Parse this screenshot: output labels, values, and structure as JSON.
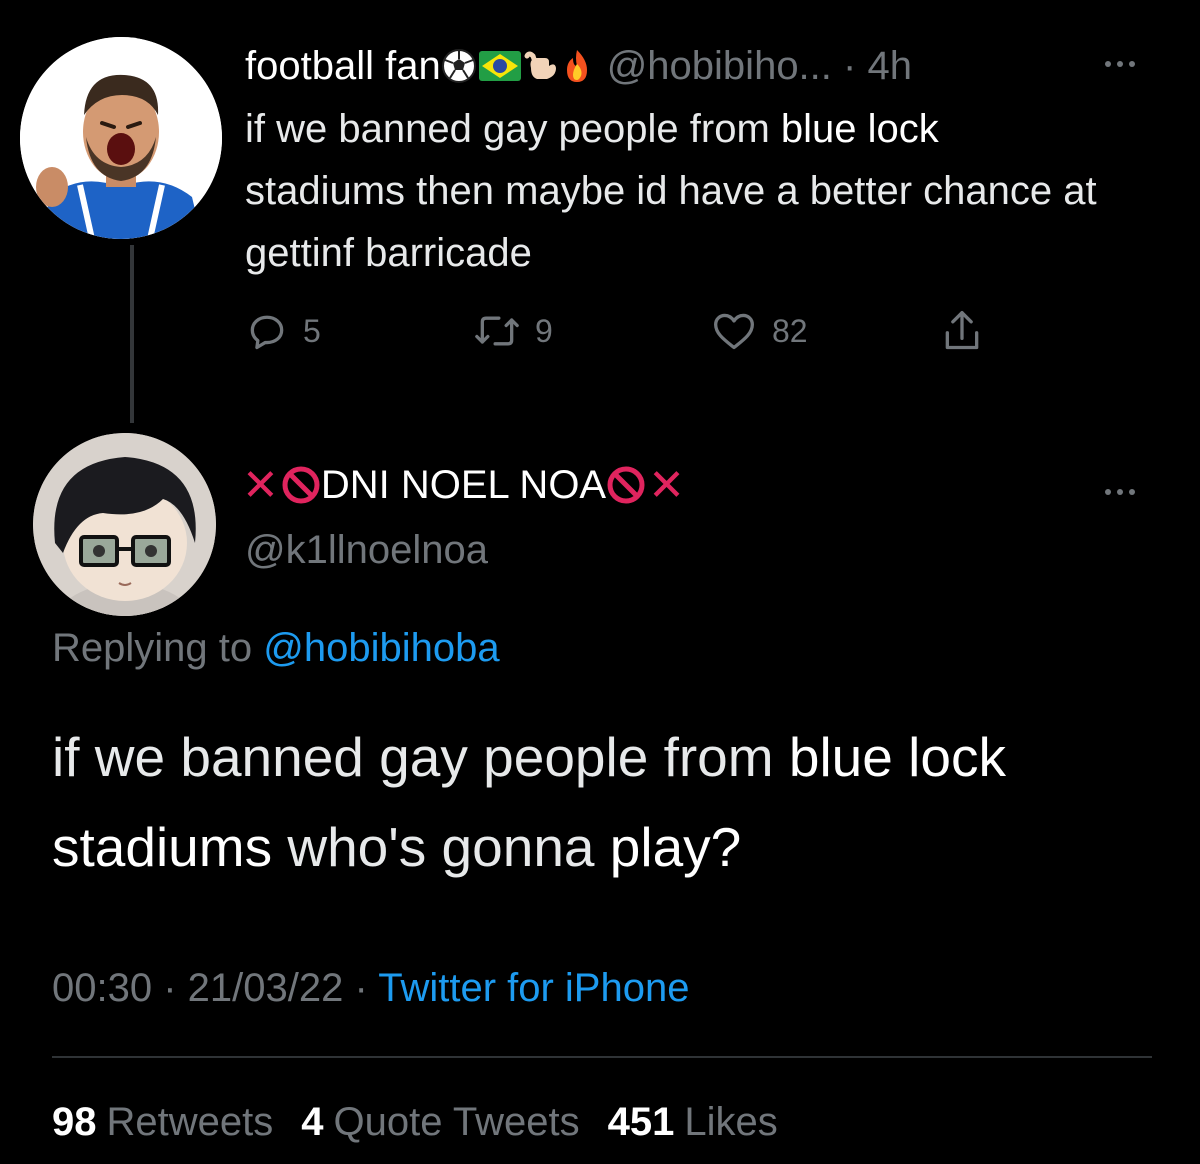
{
  "tweet": {
    "display_name": "football fan",
    "name_emojis": [
      "soccer-ball-icon",
      "brazil-flag-icon",
      "call-me-hand-icon",
      "fire-icon"
    ],
    "handle": "@hobibiho...",
    "age": "4h",
    "text_part1": "if we banned gay people from ",
    "text_highlight": "blue lock",
    "text_part2": "stadiums then maybe id have a better chance at gettinf barricade",
    "reply_count": "5",
    "retweet_count": "9",
    "like_count": "82"
  },
  "reply": {
    "display_name": "DNI NOEL NOA",
    "handle": "@k1llnoelnoa",
    "replying_prefix": "Replying to ",
    "replying_handle": "@hobibihoba",
    "text_part1": "if we banned gay people from ",
    "text_highlight1": "blue lock",
    "text_highlight2": "stadiums",
    "text_part2": " who's gonna ",
    "text_highlight3": "play?",
    "time": "00:30",
    "date": "21/03/22",
    "source": "Twitter for iPhone"
  },
  "stats": {
    "retweets_count": "98",
    "retweets_label": "Retweets",
    "quotes_count": "4",
    "quotes_label": "Quote Tweets",
    "likes_count": "451",
    "likes_label": "Likes"
  },
  "colors": {
    "background": "#000000",
    "muted": "#71767b",
    "link": "#1d9bf0",
    "x_mark": "#e0245e"
  }
}
